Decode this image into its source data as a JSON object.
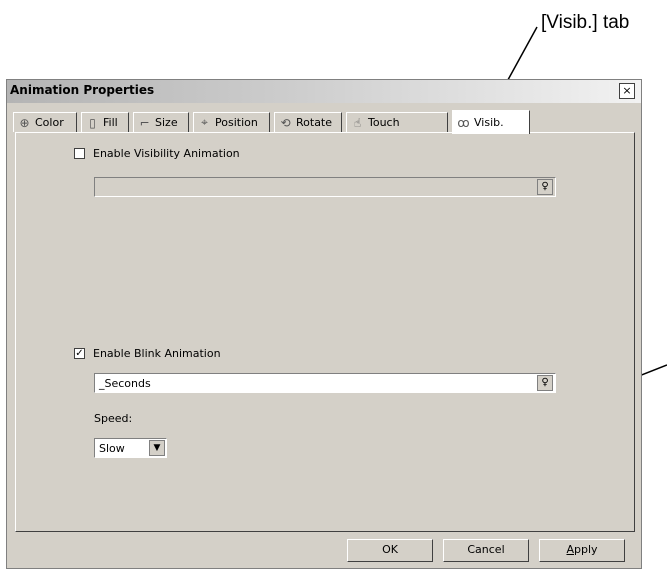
{
  "callout": {
    "label": "[Visib.] tab"
  },
  "window": {
    "title": "Animation Properties",
    "close_glyph": "×"
  },
  "tabs": [
    {
      "label": "Color",
      "icon": "color-wheel-icon",
      "glyph": "⊕"
    },
    {
      "label": "Fill",
      "icon": "fill-icon",
      "glyph": "▯"
    },
    {
      "label": "Size",
      "icon": "size-icon",
      "glyph": "⌐"
    },
    {
      "label": "Position",
      "icon": "position-icon",
      "glyph": "⌖"
    },
    {
      "label": "Rotate",
      "icon": "rotate-icon",
      "glyph": "⟲"
    },
    {
      "label": "Touch",
      "icon": "hand-icon",
      "glyph": "☝"
    },
    {
      "label": "Visib.",
      "icon": "glasses-icon",
      "glyph": "ꝏ",
      "active": true
    }
  ],
  "visibility": {
    "checkbox_label": "Enable Visibility Animation",
    "checked": false,
    "expression": ""
  },
  "blink": {
    "checkbox_label": "Enable Blink Animation",
    "checked": true,
    "check_glyph": "✓",
    "expression": "_Seconds",
    "speed_label": "Speed:",
    "speed_value": "Slow"
  },
  "buttons": {
    "ok": "OK",
    "cancel": "Cancel",
    "apply_first": "A",
    "apply_rest": "pply"
  },
  "picker_glyph": "♀",
  "dropdown_glyph": "▼"
}
